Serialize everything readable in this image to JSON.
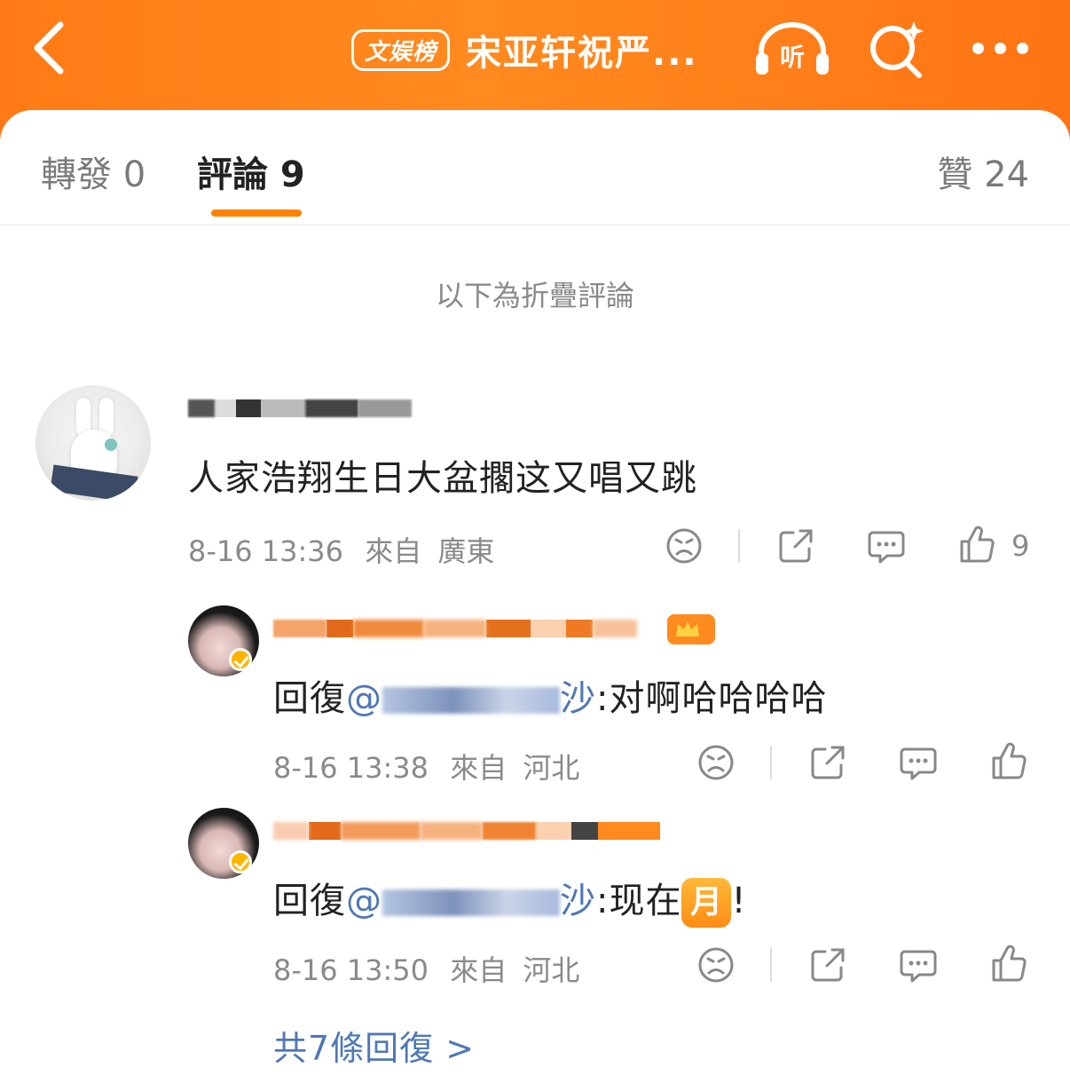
{
  "header": {
    "back_icon": "chevron-left-icon",
    "badge": "文娱榜",
    "title": "宋亚轩祝严...",
    "listen_label": "听",
    "colors": {
      "bar": "#ff7a16",
      "accent": "#ff8200",
      "link": "#4f78b5"
    }
  },
  "tabs": {
    "forward": "轉發 0",
    "comment": "評論 9",
    "like": "贊 24"
  },
  "folded_note": "以下為折疊評論",
  "comment": {
    "text": "人家浩翔生日大盆擱这又唱又跳",
    "time": "8-16 13:36",
    "source": "來自",
    "location": "廣東",
    "like_count": "9"
  },
  "replies": [
    {
      "prefix": "回復",
      "mention_at": "@",
      "mention_tail": "沙",
      "text": ":对啊哈哈哈哈",
      "time": "8-16 13:38",
      "source": "來自",
      "location": "河北"
    },
    {
      "prefix": "回復",
      "mention_at": "@",
      "mention_tail": "沙",
      "text": ":现在",
      "emoji": "月",
      "suffix": "!",
      "time": "8-16 13:50",
      "source": "來自",
      "location": "河北"
    }
  ],
  "more_replies": "共7條回復 >"
}
